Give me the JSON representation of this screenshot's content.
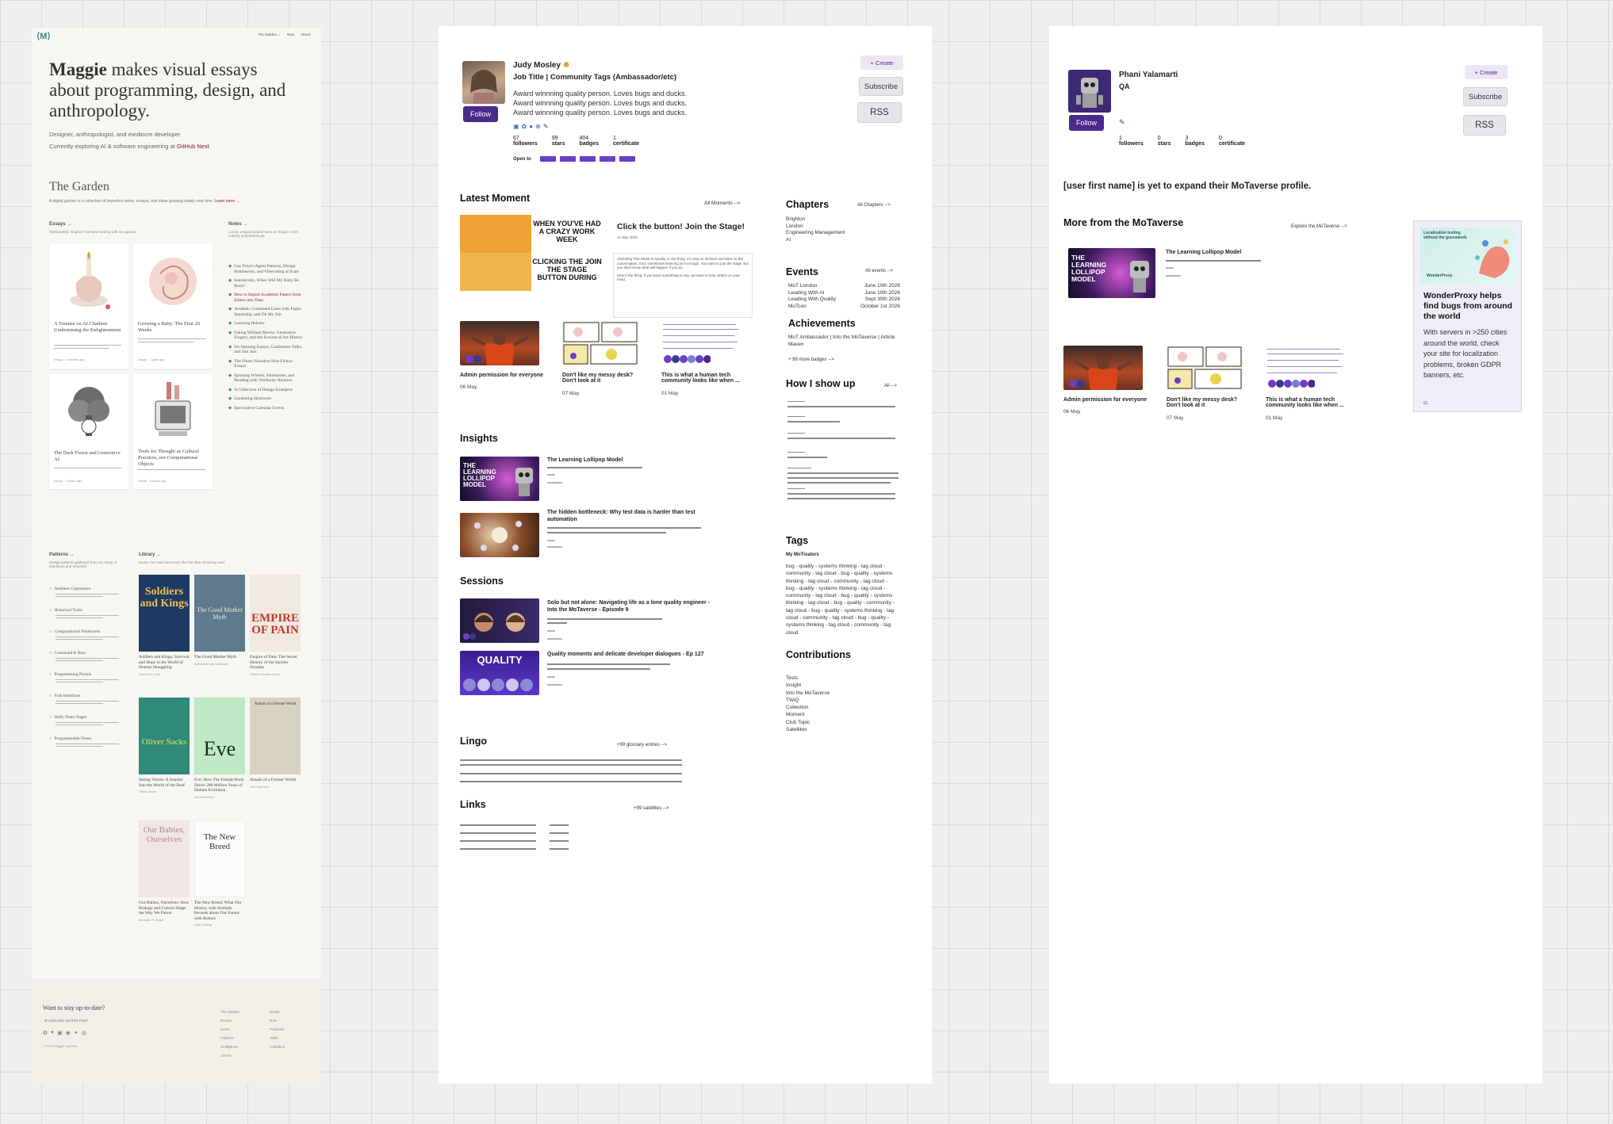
{
  "maggie": {
    "logo": "⟨M⟩",
    "nav": [
      "The Garden ⌄",
      "Now",
      "About"
    ],
    "headline_bold": "Maggie",
    "headline_rest": " makes visual essays about programming, design, and anthropology.",
    "sub1": "Designer, anthropologist, and mediocre developer",
    "sub2": "Currently exploring AI & software engineering at ",
    "sub2_link": "GitHub Next",
    "garden_title": "The Garden",
    "garden_desc": "A digital garden is a collection of imperfect notes, essays, and ideas growing slowly over time. ",
    "garden_learn": "Learn more →",
    "essays_title": "Essays →",
    "essays_desc": "Opinionated, longform narrative writing with an agenda",
    "essays": [
      {
        "title": "A Treatise on AI Chatbots Undermining the Enlightenment",
        "meta": "Essay · 8 months ago"
      },
      {
        "title": "Growing a Baby: The First 20 Weeks",
        "meta": "Essay · 1 year ago"
      },
      {
        "title": "The Dark Forest and Generative AI",
        "meta": "Essay · 2 years ago"
      },
      {
        "title": "Tools for Thought as Cultural Practices, not Computational Objects",
        "meta": "Essay · 2 years ago"
      }
    ],
    "notes_title": "Notes →",
    "notes_desc": "Loose, unopinionated notes on things I don't entirely understand yet.",
    "notes": [
      "Gas Town's Agent Patterns, Design Bottlenecks, and Vibecoding at Scale",
      "Statistically, When Will My Baby Be Born?",
      "How to Import Academic Papers from Zotero into Tana",
      "Aesthetic Command Lines with Figlet, Spaceship, and Oh My Zsh",
      "Learning Hebrew",
      "Faking William Morris, Generative Forgery, and the Erosion of Art History",
      "On Opening Essays, Conference Talks, and Jam Jars",
      "The Finest Narrative Non-Fiction Essays",
      "Spinning Wheels, Sandstones, and Reading with Vestibular Neurons",
      "A Collection of Design Examples",
      "Gardening Structures",
      "Speculative Calendar Events"
    ],
    "patterns_title": "Patterns →",
    "patterns_desc": "Design patterns gathered from my study of interfaces and research",
    "patterns": [
      "Ambient Copresence",
      "Historical Trails",
      "Computational Notebooks",
      "Command K Bars",
      "Programming Portals",
      "Folk Interfaces",
      "Daily Notes Pages",
      "Programmable Notes"
    ],
    "library_title": "Library →",
    "library_desc": "Books I've read and loved, like the idea of having read",
    "books": [
      {
        "cover": "Soldiers and Kings",
        "title": "Soldiers and Kings: Survival and Hope in the World of Human Smuggling",
        "author": "Jason De León"
      },
      {
        "cover": "The Good Mother Myth",
        "title": "The Good Mother Myth",
        "author": "Avital Norman Nathman"
      },
      {
        "cover": "EMPIRE OF PAIN",
        "title": "Empire of Pain: The Secret History of the Sackler Dynasty",
        "author": "Patrick Radden Keefe"
      },
      {
        "cover": "Oliver Sacks",
        "title": "Seeing Voices: A Journey Into the World of the Deaf",
        "author": "Oliver Sacks"
      },
      {
        "cover": "Eve",
        "title": "Eve: How The Female Body Drove 200 Million Years of Human Evolution",
        "author": "Cat Bohannon"
      },
      {
        "cover": "Annals of a Former World",
        "title": "Annals of a Former World",
        "author": "John McPhee"
      },
      {
        "cover": "Our Babies, Ourselves",
        "title": "Our Babies, Ourselves: How Biology and Culture Shape the Way We Parent",
        "author": "Meredith F. Small"
      },
      {
        "cover": "The New Breed",
        "title": "The New Breed: What Our History with Animals Reveals about Our Future with Robots",
        "author": "Kate Darling"
      }
    ],
    "footer_title": "Want to stay up-to-date?",
    "footer_sub": "Subscribe via RSS Feed",
    "copyright": "© 2025 Maggie Appleton",
    "footer_col1": [
      "The Garden",
      "Essays",
      "Notes",
      "Patterns",
      "Smidgeons",
      "Library"
    ],
    "footer_col2": [
      "Books",
      "Now",
      "Podcasts",
      "Talks",
      "Colophon"
    ]
  },
  "judy": {
    "name": "Judy Mosley",
    "job": "Job Title | Community Tags (Ambassador/etc)",
    "bio": [
      "Award winnning quality person. Loves bugs and ducks.",
      "Award winnning quality person. Loves bugs and ducks.",
      "Award winnning quality person. Loves bugs and ducks."
    ],
    "follow": "Follow",
    "create": "+ Create",
    "subscribe": "Subscribe",
    "rss": "RSS",
    "stats": [
      {
        "n": "67",
        "l": "followers"
      },
      {
        "n": "99",
        "l": "stars"
      },
      {
        "n": "404",
        "l": "badges"
      },
      {
        "n": "1",
        "l": "certificate"
      }
    ],
    "open_to": "Open to",
    "latest_moment": "Latest Moment",
    "all_moments": "All Moments -->",
    "meme_top": "WHEN YOU'VE HAD A CRAZY WORK WEEK",
    "meme_bottom": "CLICKING THE JOIN THE STAGE BUTTON DURING",
    "moment_title": "Click the button! Join the Stage!",
    "moment_date": "11 May 2025",
    "moment_body": "Attending This Week in Quality is one thing. It's easy to sit back and listen to the conversation. And, sometimes listening isn't enough. You want to join the stage, but you don't know what will happen if you do.",
    "moment_body2": "Here's the thing: if you have something to say, we want to hear what's on your mind.",
    "posts": [
      {
        "title": "Admin permission for everyone",
        "date": "06 May"
      },
      {
        "title": "Don't like my messy desk? Don't look at it",
        "date": "07 May"
      },
      {
        "title": "This is what a human tech community looks like when ...",
        "date": "01 May"
      }
    ],
    "chapters_title": "Chapters",
    "all_chapters": "All Chapters -->",
    "chapters": [
      "Brighton",
      "London",
      "Engineering Management",
      "AI"
    ],
    "events_title": "Events",
    "all_events": "All events -->",
    "events": [
      {
        "n": "MoT London",
        "d": "June 10th 2026"
      },
      {
        "n": "Leading With AI",
        "d": "June 10th 2026"
      },
      {
        "n": "Leading With Quality",
        "d": "Sept 30th 2026"
      },
      {
        "n": "MoTcon",
        "d": "October 1st 2026"
      }
    ],
    "achievements_title": "Achievements",
    "achievements": "MoT Ambassador | Into the MoTaverse | Article Maven",
    "more_badges": "+ 99 more badges -->",
    "howishow_title": "How I show up",
    "all_link": "All -->",
    "insights_title": "Insights",
    "insights": [
      "The Learning Lollipop Model",
      "The hidden bottleneck: Why test data is harder than test automation"
    ],
    "lollipop_cover": "THE LEARNING LOLLIPOP MODEL",
    "sessions_title": "Sessions",
    "sessions": [
      "Solo but not alone: Navigating life as a lone quality engineer - Into the MoTaverse - Episode 9",
      "Quality moments and delicate developer dialogues - Ep 127"
    ],
    "session_cover2": "QUALITY",
    "tags_title": "Tags",
    "my_motivators": "My MoTivators",
    "tag_text": "bug - quality - systems thinking - tag cloud - community - tag cloud - bug - quality - systems thinking - tag cloud - community - tag cloud - bug - quality - systems thinking - tag cloud - community - tag cloud - bug - quality - systems thinking - tag cloud - bug - quality - community - tag cloud - bug - quality - systems thinking - tag cloud - community - tag cloud - bug - quality - systems thinking - tag cloud - community - tag cloud",
    "contributions_title": "Contributions",
    "contributions": [
      "Tests",
      "Insight",
      "Into the MoTaverse",
      "TWiQ",
      "Collection",
      "Moment",
      "Club Topic",
      "Satellites"
    ],
    "lingo_title": "Lingo",
    "lingo_link": "+99 glossary entries -->",
    "links_title": "Links",
    "links_link": "+99 satellites -->"
  },
  "phani": {
    "name": "Phani Yalamarti",
    "role": "QA",
    "follow": "Follow",
    "create": "+ Create",
    "subscribe": "Subscribe",
    "rss": "RSS",
    "stats": [
      {
        "n": "1",
        "l": "followers"
      },
      {
        "n": "0",
        "l": "stars"
      },
      {
        "n": "3",
        "l": "badges"
      },
      {
        "n": "0",
        "l": "certificate"
      }
    ],
    "empty_msg": "[user first name] is yet to expand their MoTaverse profile.",
    "more_title": "More from the MoTaverse",
    "explore": "Explore the MoTaverse -->",
    "insight": "The Learning Lollipop Model",
    "posts": [
      {
        "title": "Admin permission for everyone",
        "date": "06 May"
      },
      {
        "title": "Don't like my messy desk? Don't look at it",
        "date": "07 May"
      },
      {
        "title": "This is what a human tech community looks like when ...",
        "date": "01 May"
      }
    ],
    "ad_head": "Localization testing without the guesswork.",
    "ad_brand": "WonderProxy",
    "ad_title": "WonderProxy helps find bugs from around the world",
    "ad_body": "With servers in >250 cities around the world, check your site for localization problems, broken GDPR banners, etc."
  },
  "colors": {
    "purple": "#4b2a8c",
    "maggie_bg": "#f7f6f1",
    "accent_red": "#8a1538",
    "teal": "#3a8a88"
  }
}
